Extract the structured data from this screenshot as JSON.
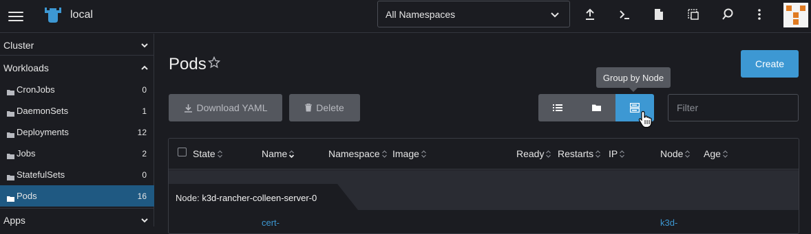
{
  "topbar": {
    "cluster_name": "local",
    "namespace_select": "All Namespaces",
    "icons": [
      "hamburger-icon",
      "cluster-icon",
      "upload-icon",
      "terminal-icon",
      "file-icon",
      "copy-config-icon",
      "search-icon",
      "more-vertical-icon",
      "avatar"
    ]
  },
  "sidebar": {
    "groups": [
      {
        "label": "Cluster",
        "expanded": false
      },
      {
        "label": "Workloads",
        "expanded": true
      },
      {
        "label": "Apps",
        "expanded": false
      }
    ],
    "items": [
      {
        "label": "CronJobs",
        "count": "0"
      },
      {
        "label": "DaemonSets",
        "count": "1"
      },
      {
        "label": "Deployments",
        "count": "12"
      },
      {
        "label": "Jobs",
        "count": "2"
      },
      {
        "label": "StatefulSets",
        "count": "0"
      },
      {
        "label": "Pods",
        "count": "16",
        "active": true
      }
    ]
  },
  "main": {
    "title": "Pods",
    "create_label": "Create",
    "download_label": "Download YAML",
    "delete_label": "Delete",
    "tooltip": "Group by Node",
    "filter_placeholder": "Filter",
    "columns": [
      "State",
      "Name",
      "Namespace",
      "Image",
      "Ready",
      "Restarts",
      "IP",
      "Node",
      "Age"
    ],
    "group": {
      "prefix": "Node:",
      "value": "k3d-rancher-colleen-server-0"
    },
    "row_partial": {
      "name": "cert-",
      "node": "k3d-"
    }
  },
  "colors": {
    "accent": "#3d98d3",
    "active_nav": "#1f5982",
    "background": "#1b1c21",
    "button_gray": "#54575e"
  }
}
